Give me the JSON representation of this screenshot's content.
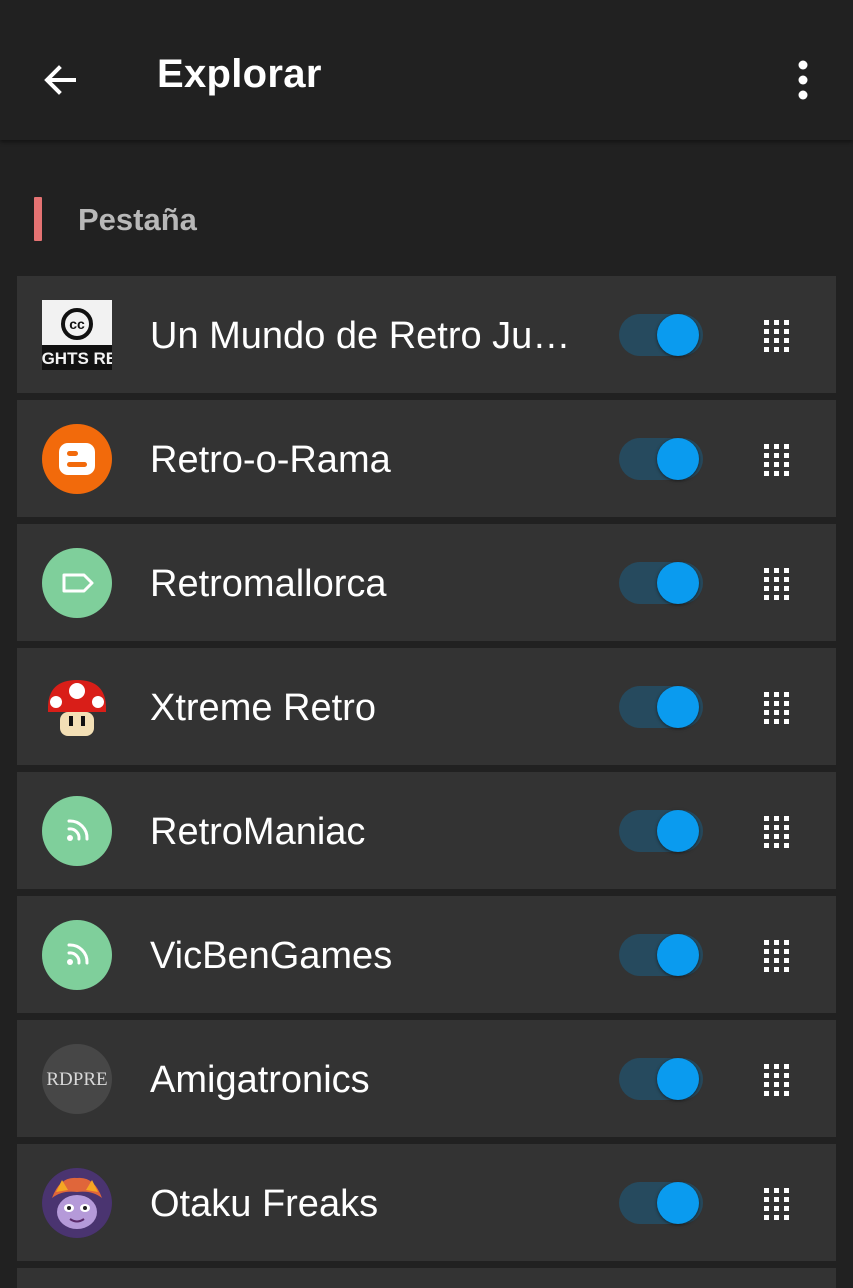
{
  "appbar": {
    "title": "Explorar",
    "back_icon": "arrow-back-icon",
    "menu_icon": "more-vert-icon"
  },
  "section": {
    "title": "Pestaña",
    "accent_color": "#e57373"
  },
  "colors": {
    "background": "#212121",
    "row_background": "#333333",
    "toggle_thumb": "#0a9bef",
    "toggle_track": "#264a5e",
    "feed_green": "#7fcf9b"
  },
  "feeds": [
    {
      "name": "Un Mundo de Retro Juegos",
      "icon": "creative-commons-logo-icon",
      "enabled": true
    },
    {
      "name": "Retro-o-Rama",
      "icon": "blogger-logo-icon",
      "enabled": true
    },
    {
      "name": "Retromallorca",
      "icon": "tag-icon",
      "enabled": true
    },
    {
      "name": "Xtreme Retro",
      "icon": "mushroom-icon",
      "enabled": true
    },
    {
      "name": "RetroManiac",
      "icon": "rss-icon",
      "enabled": true
    },
    {
      "name": "VicBenGames",
      "icon": "rss-icon",
      "enabled": true
    },
    {
      "name": "Amigatronics",
      "icon": "wordpress-logo-icon",
      "enabled": true
    },
    {
      "name": "Otaku Freaks",
      "icon": "character-avatar-icon",
      "enabled": true
    }
  ]
}
